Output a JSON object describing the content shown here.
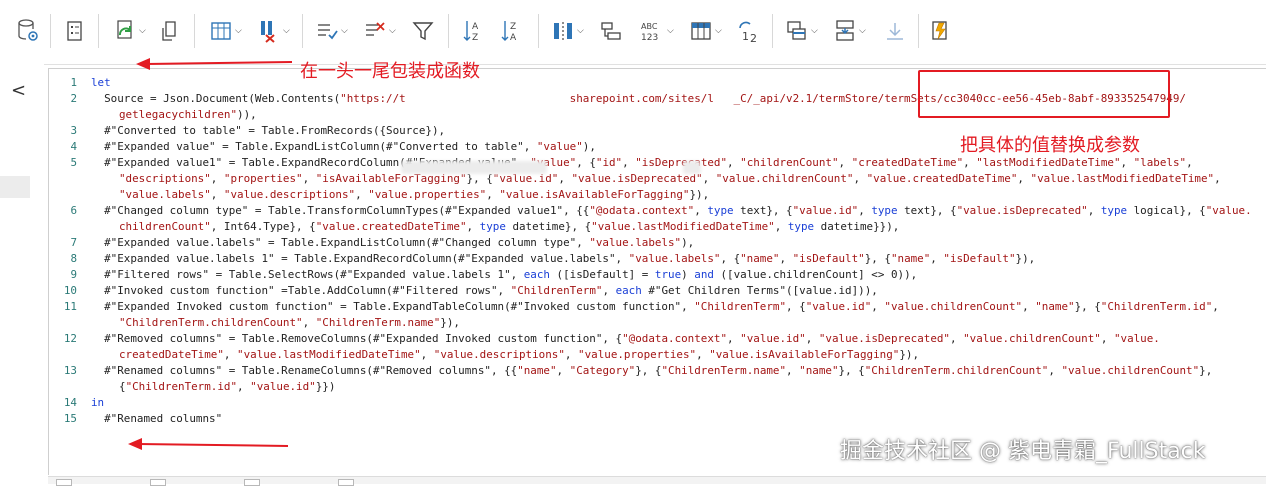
{
  "toolbar": {
    "icons": [
      "data-source-settings-icon",
      "properties-icon",
      "refresh-icon",
      "manage-icon",
      "choose-columns-icon",
      "remove-columns-icon",
      "keep-rows-icon",
      "remove-rows-icon",
      "filter-icon",
      "sort-ascending-icon",
      "sort-descending-icon",
      "split-column-icon",
      "group-by-icon",
      "data-type-icon",
      "use-first-row-icon",
      "replace-values-icon",
      "merge-queries-icon",
      "append-queries-icon",
      "combine-files-icon",
      "advanced-editor-icon"
    ]
  },
  "leftnav": {
    "collapse_glyph": "<"
  },
  "annotations": {
    "wrap_function": "在一头一尾包装成函数",
    "replace_params": "把具体的值替换成参数",
    "accent": "#e31b23"
  },
  "watermark": "掘金技术社区 @ 紫电青霜_FullStack",
  "code": [
    {
      "n": "1",
      "segs": [
        [
          "let",
          "kw"
        ]
      ]
    },
    {
      "n": "2",
      "segs": [
        [
          "  Source = Json.Document(Web.Contents(",
          ""
        ],
        [
          "\"https://t                         sharepoint.com/sites/l   _C/_api/v2.1/termStore/termSets/cc3040cc-ee56-45eb-8abf-893352547949/",
          "str"
        ]
      ]
    },
    {
      "n": "",
      "cont": true,
      "segs": [
        [
          "getlegacychildren\"",
          "str"
        ],
        [
          ")),",
          ""
        ]
      ]
    },
    {
      "n": "3",
      "segs": [
        [
          "  #\"Converted to table\" = Table.FromRecords({Source}),",
          ""
        ]
      ]
    },
    {
      "n": "4",
      "segs": [
        [
          "  #\"Expanded value\" = Table.ExpandListColumn(#\"Converted to table\", ",
          ""
        ],
        [
          "\"value\"",
          "str"
        ],
        [
          "),",
          ""
        ]
      ]
    },
    {
      "n": "5",
      "segs": [
        [
          "  #\"Expanded value1\" = Table.ExpandRecordColumn(#\"Expanded value\", ",
          ""
        ],
        [
          "\"value\"",
          "str"
        ],
        [
          ", {",
          ""
        ],
        [
          "\"id\"",
          "str"
        ],
        [
          ", ",
          ""
        ],
        [
          "\"isDeprecated\"",
          "str"
        ],
        [
          ", ",
          ""
        ],
        [
          "\"childrenCount\"",
          "str"
        ],
        [
          ", ",
          ""
        ],
        [
          "\"createdDateTime\"",
          "str"
        ],
        [
          ", ",
          ""
        ],
        [
          "\"lastModifiedDateTime\"",
          "str"
        ],
        [
          ", ",
          ""
        ],
        [
          "\"labels\"",
          "str"
        ],
        [
          ",",
          ""
        ]
      ]
    },
    {
      "n": "",
      "cont": true,
      "segs": [
        [
          "\"descriptions\"",
          "str"
        ],
        [
          ", ",
          ""
        ],
        [
          "\"properties\"",
          "str"
        ],
        [
          ", ",
          ""
        ],
        [
          "\"isAvailableForTagging\"",
          "str"
        ],
        [
          "}, {",
          ""
        ],
        [
          "\"value.id\"",
          "str"
        ],
        [
          ", ",
          ""
        ],
        [
          "\"value.isDeprecated\"",
          "str"
        ],
        [
          ", ",
          ""
        ],
        [
          "\"value.childrenCount\"",
          "str"
        ],
        [
          ", ",
          ""
        ],
        [
          "\"value.createdDateTime\"",
          "str"
        ],
        [
          ", ",
          ""
        ],
        [
          "\"value.lastModifiedDateTime\"",
          "str"
        ],
        [
          ",",
          ""
        ]
      ]
    },
    {
      "n": "",
      "cont": true,
      "segs": [
        [
          "\"value.labels\"",
          "str"
        ],
        [
          ", ",
          ""
        ],
        [
          "\"value.descriptions\"",
          "str"
        ],
        [
          ", ",
          ""
        ],
        [
          "\"value.properties\"",
          "str"
        ],
        [
          ", ",
          ""
        ],
        [
          "\"value.isAvailableForTagging\"",
          "str"
        ],
        [
          "}),",
          ""
        ]
      ]
    },
    {
      "n": "6",
      "segs": [
        [
          "  #\"Changed column type\" = Table.TransformColumnTypes(#\"Expanded value1\", {{",
          ""
        ],
        [
          "\"@odata.context\"",
          "str"
        ],
        [
          ", ",
          ""
        ],
        [
          "type",
          "kw"
        ],
        [
          " text}, {",
          ""
        ],
        [
          "\"value.id\"",
          "str"
        ],
        [
          ", ",
          ""
        ],
        [
          "type",
          "kw"
        ],
        [
          " text}, {",
          ""
        ],
        [
          "\"value.isDeprecated\"",
          "str"
        ],
        [
          ", ",
          ""
        ],
        [
          "type",
          "kw"
        ],
        [
          " logical}, {",
          ""
        ],
        [
          "\"value.",
          "str"
        ]
      ]
    },
    {
      "n": "",
      "cont": true,
      "segs": [
        [
          "childrenCount\"",
          "str"
        ],
        [
          ", Int64.Type}, {",
          ""
        ],
        [
          "\"value.createdDateTime\"",
          "str"
        ],
        [
          ", ",
          ""
        ],
        [
          "type",
          "kw"
        ],
        [
          " datetime}, {",
          ""
        ],
        [
          "\"value.lastModifiedDateTime\"",
          "str"
        ],
        [
          ", ",
          ""
        ],
        [
          "type",
          "kw"
        ],
        [
          " datetime}}),",
          ""
        ]
      ]
    },
    {
      "n": "7",
      "segs": [
        [
          "  #\"Expanded value.labels\" = Table.ExpandListColumn(#\"Changed column type\", ",
          ""
        ],
        [
          "\"value.labels\"",
          "str"
        ],
        [
          "),",
          ""
        ]
      ]
    },
    {
      "n": "8",
      "segs": [
        [
          "  #\"Expanded value.labels 1\" = Table.ExpandRecordColumn(#\"Expanded value.labels\", ",
          ""
        ],
        [
          "\"value.labels\"",
          "str"
        ],
        [
          ", {",
          ""
        ],
        [
          "\"name\"",
          "str"
        ],
        [
          ", ",
          ""
        ],
        [
          "\"isDefault\"",
          "str"
        ],
        [
          "}, {",
          ""
        ],
        [
          "\"name\"",
          "str"
        ],
        [
          ", ",
          ""
        ],
        [
          "\"isDefault\"",
          "str"
        ],
        [
          "}),",
          ""
        ]
      ]
    },
    {
      "n": "9",
      "segs": [
        [
          "  #\"Filtered rows\" = Table.SelectRows(#\"Expanded value.labels 1\", ",
          ""
        ],
        [
          "each",
          "kw"
        ],
        [
          " ([isDefault] = ",
          ""
        ],
        [
          "true",
          "kw"
        ],
        [
          ") ",
          ""
        ],
        [
          "and",
          "kw"
        ],
        [
          " ([value.childrenCount] <> 0)),",
          ""
        ]
      ]
    },
    {
      "n": "10",
      "segs": [
        [
          "  #\"Invoked custom function\" =Table.AddColumn(#\"Filtered rows\", ",
          ""
        ],
        [
          "\"ChildrenTerm\"",
          "str"
        ],
        [
          ", ",
          ""
        ],
        [
          "each",
          "kw"
        ],
        [
          " #\"Get Children Terms\"([value.id])),",
          ""
        ]
      ]
    },
    {
      "n": "11",
      "segs": [
        [
          "  #\"Expanded Invoked custom function\" = Table.ExpandTableColumn(#\"Invoked custom function\", ",
          ""
        ],
        [
          "\"ChildrenTerm\"",
          "str"
        ],
        [
          ", {",
          ""
        ],
        [
          "\"value.id\"",
          "str"
        ],
        [
          ", ",
          ""
        ],
        [
          "\"value.childrenCount\"",
          "str"
        ],
        [
          ", ",
          ""
        ],
        [
          "\"name\"",
          "str"
        ],
        [
          "}, {",
          ""
        ],
        [
          "\"ChildrenTerm.id\"",
          "str"
        ],
        [
          ",",
          ""
        ]
      ]
    },
    {
      "n": "",
      "cont": true,
      "segs": [
        [
          "\"ChildrenTerm.childrenCount\"",
          "str"
        ],
        [
          ", ",
          ""
        ],
        [
          "\"ChildrenTerm.name\"",
          "str"
        ],
        [
          "}),",
          ""
        ]
      ]
    },
    {
      "n": "12",
      "segs": [
        [
          "  #\"Removed columns\" = Table.RemoveColumns(#\"Expanded Invoked custom function\", {",
          ""
        ],
        [
          "\"@odata.context\"",
          "str"
        ],
        [
          ", ",
          ""
        ],
        [
          "\"value.id\"",
          "str"
        ],
        [
          ", ",
          ""
        ],
        [
          "\"value.isDeprecated\"",
          "str"
        ],
        [
          ", ",
          ""
        ],
        [
          "\"value.childrenCount\"",
          "str"
        ],
        [
          ", ",
          ""
        ],
        [
          "\"value.",
          "str"
        ]
      ]
    },
    {
      "n": "",
      "cont": true,
      "segs": [
        [
          "createdDateTime\"",
          "str"
        ],
        [
          ", ",
          ""
        ],
        [
          "\"value.lastModifiedDateTime\"",
          "str"
        ],
        [
          ", ",
          ""
        ],
        [
          "\"value.descriptions\"",
          "str"
        ],
        [
          ", ",
          ""
        ],
        [
          "\"value.properties\"",
          "str"
        ],
        [
          ", ",
          ""
        ],
        [
          "\"value.isAvailableForTagging\"",
          "str"
        ],
        [
          "}),",
          ""
        ]
      ]
    },
    {
      "n": "13",
      "segs": [
        [
          "  #\"Renamed columns\" = Table.RenameColumns(#\"Removed columns\", {{",
          ""
        ],
        [
          "\"name\"",
          "str"
        ],
        [
          ", ",
          ""
        ],
        [
          "\"Category\"",
          "str"
        ],
        [
          "}, {",
          ""
        ],
        [
          "\"ChildrenTerm.name\"",
          "str"
        ],
        [
          ", ",
          ""
        ],
        [
          "\"name\"",
          "str"
        ],
        [
          "}, {",
          ""
        ],
        [
          "\"ChildrenTerm.childrenCount\"",
          "str"
        ],
        [
          ", ",
          ""
        ],
        [
          "\"value.childrenCount\"",
          "str"
        ],
        [
          "},",
          ""
        ]
      ]
    },
    {
      "n": "",
      "cont": true,
      "segs": [
        [
          "{",
          ""
        ],
        [
          "\"ChildrenTerm.id\"",
          "str"
        ],
        [
          ", ",
          ""
        ],
        [
          "\"value.id\"",
          "str"
        ],
        [
          "}})",
          ""
        ]
      ]
    },
    {
      "n": "14",
      "segs": [
        [
          "in",
          "kw"
        ]
      ]
    },
    {
      "n": "15",
      "segs": [
        [
          "  #\"Renamed columns\"",
          ""
        ]
      ]
    }
  ]
}
